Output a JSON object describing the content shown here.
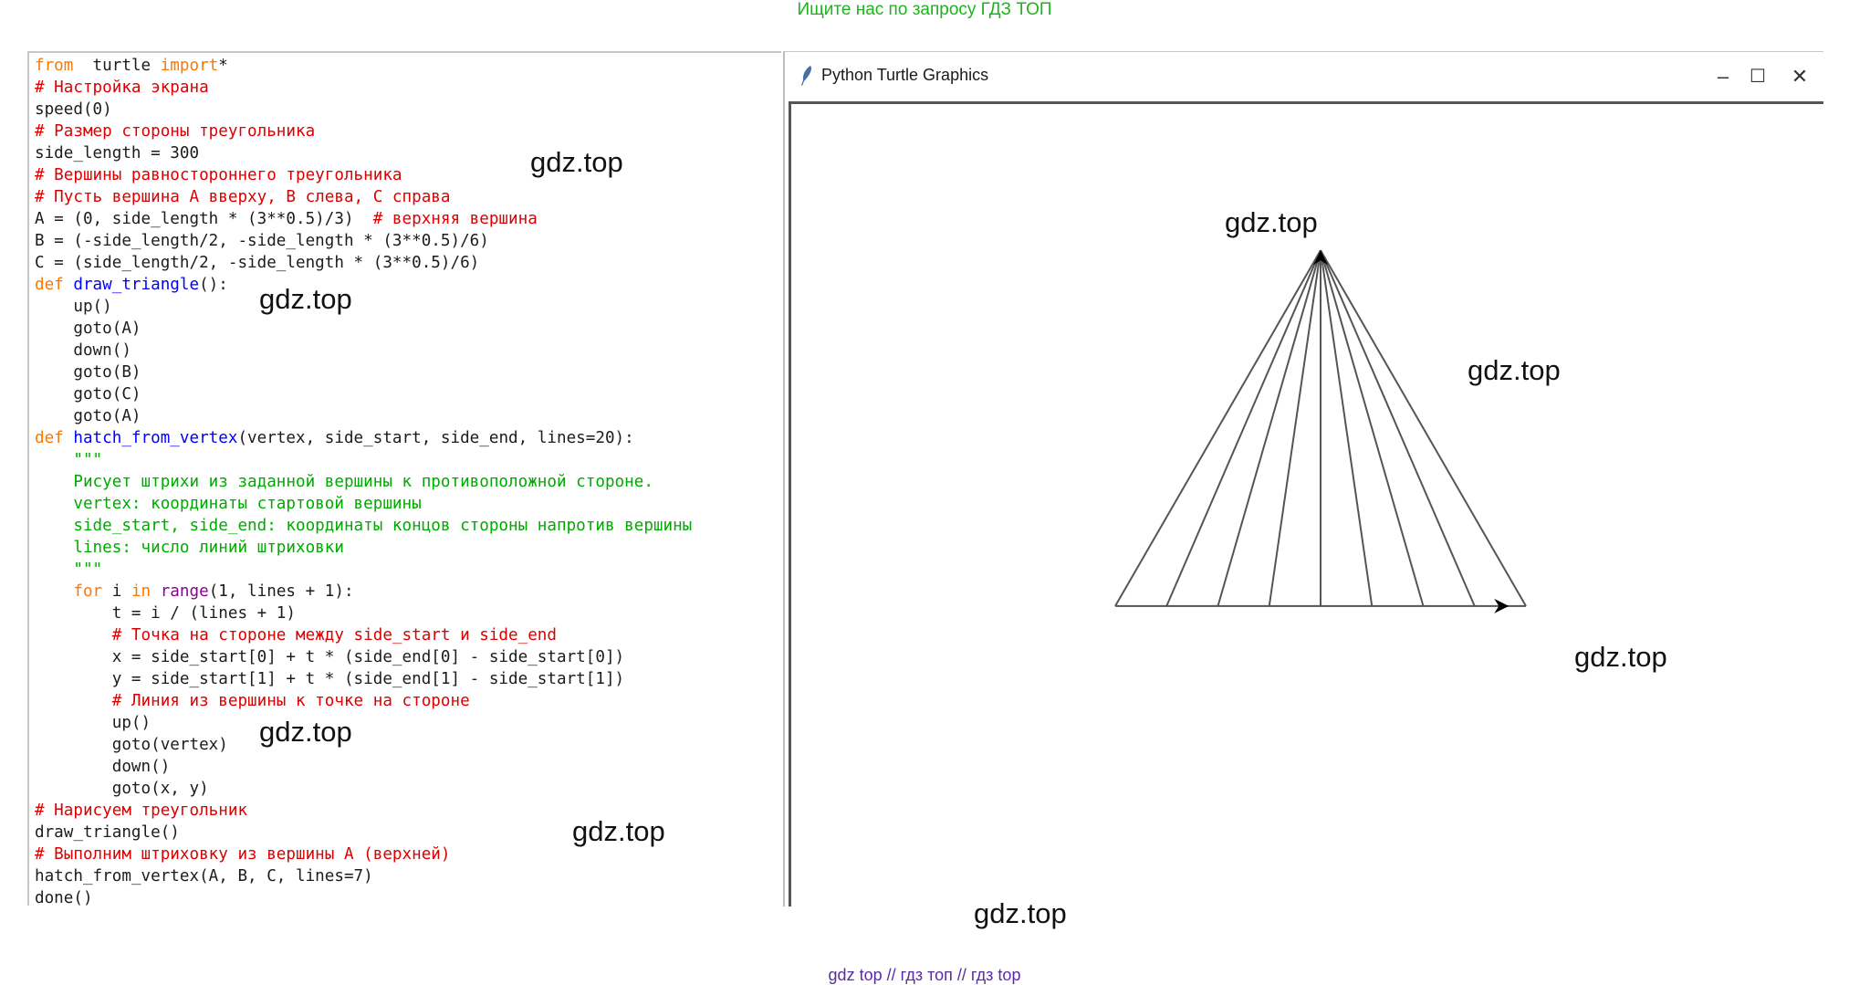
{
  "banner": {
    "top": "Ищите нас по запросу ГДЗ ТОП",
    "bottom": "gdz top  //  гдз топ  //  гдз top"
  },
  "editor": {
    "lines": [
      [
        [
          "kw",
          "from"
        ],
        [
          "",
          "  turtle "
        ],
        [
          "kw",
          "import"
        ],
        [
          "",
          "*"
        ]
      ],
      [
        [
          "cm",
          "# Настройка экрана"
        ]
      ],
      [
        [
          "",
          "speed(0)"
        ]
      ],
      [
        [
          "cm",
          "# Размер стороны треугольника"
        ]
      ],
      [
        [
          "",
          "side_length = 300"
        ]
      ],
      [
        [
          "cm",
          "# Вершины равностороннего треугольника"
        ]
      ],
      [
        [
          "cm",
          "# Пусть вершина A вверху, B слева, C справа"
        ]
      ],
      [
        [
          "",
          "A = (0, side_length * (3**0.5)/3)  "
        ],
        [
          "cm",
          "# верхняя вершина"
        ]
      ],
      [
        [
          "",
          "B = (-side_length/2, -side_length * (3**0.5)/6)"
        ]
      ],
      [
        [
          "",
          "C = (side_length/2, -side_length * (3**0.5)/6)"
        ]
      ],
      [
        [
          "kw",
          "def "
        ],
        [
          "fn",
          "draw_triangle"
        ],
        [
          "",
          "():"
        ]
      ],
      [
        [
          "",
          "    up()"
        ]
      ],
      [
        [
          "",
          "    goto(A)"
        ]
      ],
      [
        [
          "",
          "    down()"
        ]
      ],
      [
        [
          "",
          "    goto(B)"
        ]
      ],
      [
        [
          "",
          "    goto(C)"
        ]
      ],
      [
        [
          "",
          "    goto(A)"
        ]
      ],
      [
        [
          "kw",
          "def "
        ],
        [
          "fn",
          "hatch_from_vertex"
        ],
        [
          "",
          "(vertex, side_start, side_end, lines=20):"
        ]
      ],
      [
        [
          "st",
          "    \"\"\""
        ]
      ],
      [
        [
          "st",
          "    Рисует штрихи из заданной вершины к противоположной стороне."
        ]
      ],
      [
        [
          "st",
          "    vertex: координаты стартовой вершины"
        ]
      ],
      [
        [
          "st",
          "    side_start, side_end: координаты концов стороны напротив вершины"
        ]
      ],
      [
        [
          "st",
          "    lines: число линий штриховки"
        ]
      ],
      [
        [
          "st",
          "    \"\"\""
        ]
      ],
      [
        [
          "kw",
          "    for"
        ],
        [
          "",
          " i "
        ],
        [
          "kw",
          "in"
        ],
        [
          "",
          " "
        ],
        [
          "bi",
          "range"
        ],
        [
          "",
          "(1, lines + 1):"
        ]
      ],
      [
        [
          "",
          "        t = i / (lines + 1)"
        ]
      ],
      [
        [
          "cm",
          "        # Точка на стороне между side_start и side_end"
        ]
      ],
      [
        [
          "",
          "        x = side_start[0] + t * (side_end[0] - side_start[0])"
        ]
      ],
      [
        [
          "",
          "        y = side_start[1] + t * (side_end[1] - side_start[1])"
        ]
      ],
      [
        [
          "cm",
          "        # Линия из вершины к точке на стороне"
        ]
      ],
      [
        [
          "",
          "        up()"
        ]
      ],
      [
        [
          "",
          "        goto(vertex)"
        ]
      ],
      [
        [
          "",
          "        down()"
        ]
      ],
      [
        [
          "",
          "        goto(x, y)"
        ]
      ],
      [
        [
          "cm",
          "# Нарисуем треугольник"
        ]
      ],
      [
        [
          "",
          "draw_triangle()"
        ]
      ],
      [
        [
          "cm",
          "# Выполним штриховку из вершины A (верхней)"
        ]
      ],
      [
        [
          "",
          "hatch_from_vertex(A, B, C, lines=7)"
        ]
      ],
      [
        [
          "",
          "done()"
        ]
      ]
    ]
  },
  "window": {
    "title": "Python Turtle Graphics",
    "minimize": "–",
    "maximize": "☐",
    "close": "✕"
  },
  "turtle": {
    "side_length": 300,
    "hatch_lines": 7,
    "line_color": "#555555"
  },
  "watermarks": [
    "gdz.top",
    "gdz.top",
    "gdz.top",
    "gdz.top",
    "gdz.top",
    "gdz.top",
    "gdz.top",
    "gdz.top"
  ]
}
